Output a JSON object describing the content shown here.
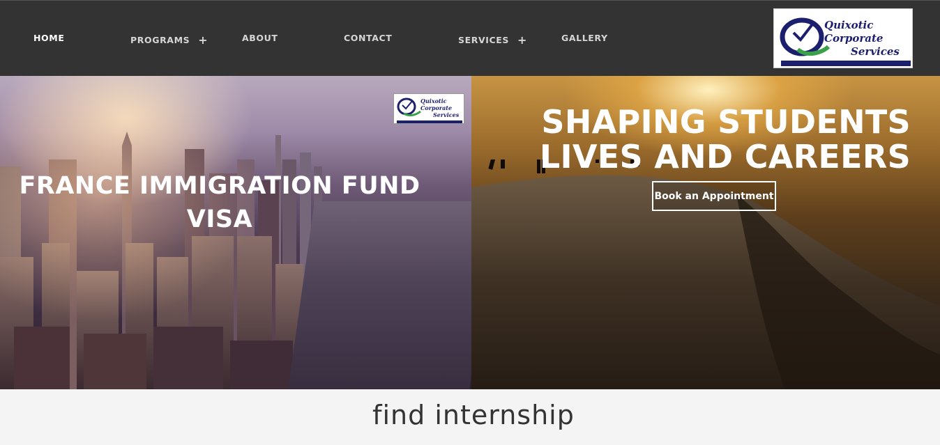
{
  "nav": {
    "items": [
      {
        "label": "HOME",
        "has_submenu": false
      },
      {
        "label": "PROGRAMS",
        "has_submenu": true
      },
      {
        "label": "ABOUT",
        "has_submenu": false
      },
      {
        "label": "CONTACT",
        "has_submenu": false
      },
      {
        "label": "SERVICES",
        "has_submenu": true
      },
      {
        "label": "GALLERY",
        "has_submenu": false
      }
    ],
    "submenu_icon": "+"
  },
  "logo": {
    "line1": "Quixotic",
    "line2": "Corporate",
    "line3": "Services",
    "brand_color": "#1c1e6e"
  },
  "hero_left": {
    "title_line1": "FRANCE IMMIGRATION FUND",
    "title_line2": "VISA",
    "logo_line1": "Quixotic",
    "logo_line2": "Corporate",
    "logo_line3": "Services"
  },
  "hero_right": {
    "title_line1": "SHAPING STUDENTS",
    "title_line2": "LIVES AND CAREERS",
    "cta_label": "Book an Appointment"
  },
  "section": {
    "heading": "find internship"
  },
  "colors": {
    "nav_bg": "#333333",
    "text_white": "#ffffff",
    "page_bg": "#f4f4f4",
    "heading_color": "#333333"
  }
}
